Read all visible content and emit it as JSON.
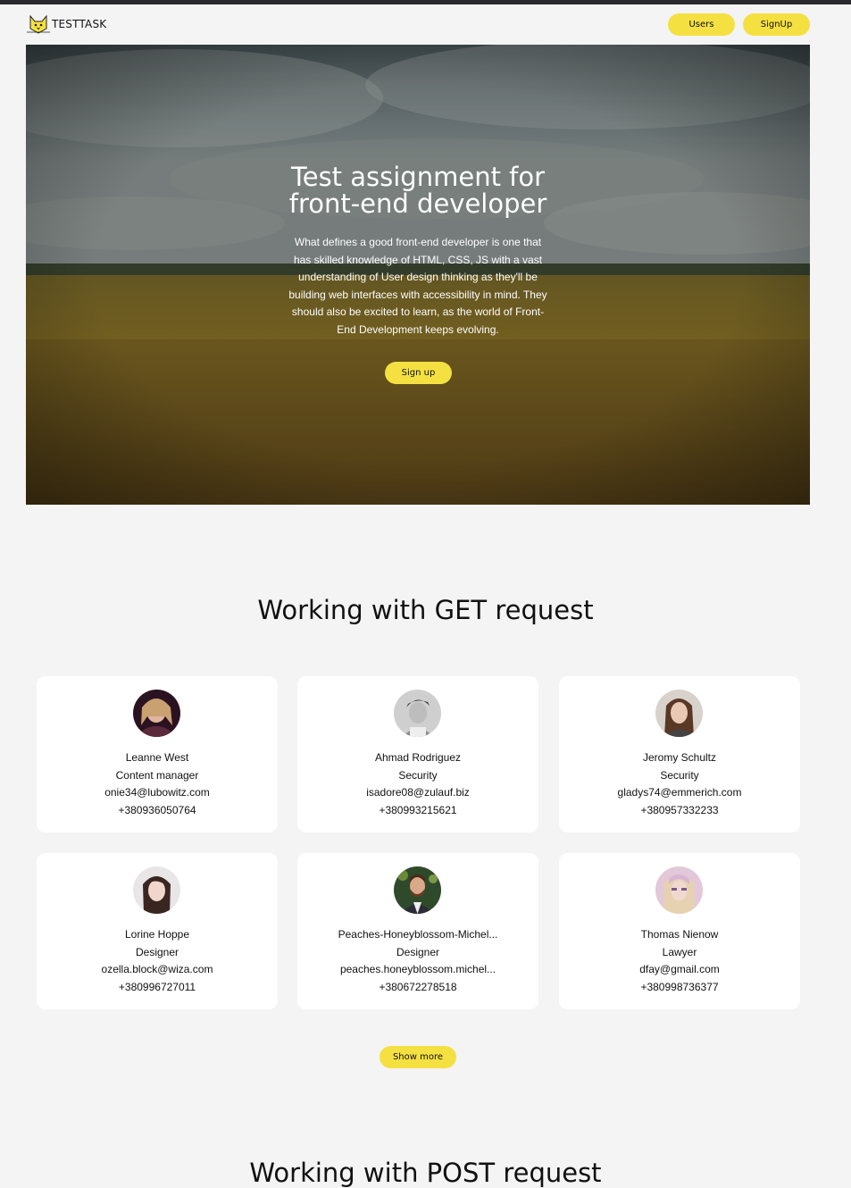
{
  "header": {
    "logo_text": "TESTTASK",
    "nav": {
      "users_label": "Users",
      "signup_label": "SignUp"
    }
  },
  "hero": {
    "title_line1": "Test assignment for",
    "title_line2": "front-end developer",
    "description": "What defines a good front-end developer is one that has skilled knowledge of HTML, CSS, JS with a vast understanding of User design thinking as they'll be building web interfaces with accessibility in mind. They should also be excited to learn, as the world of Front-End Development keeps evolving.",
    "button_label": "Sign up"
  },
  "get_section": {
    "title": "Working with GET request",
    "users": [
      {
        "name": "Leanne West",
        "position": "Content manager",
        "email": "onie34@lubowitz.com",
        "phone": "+380936050764"
      },
      {
        "name": "Ahmad Rodriguez",
        "position": "Security",
        "email": "isadore08@zulauf.biz",
        "phone": "+380993215621"
      },
      {
        "name": "Jeromy Schultz",
        "position": "Security",
        "email": "gladys74@emmerich.com",
        "phone": "+380957332233"
      },
      {
        "name": "Lorine Hoppe",
        "position": "Designer",
        "email": "ozella.block@wiza.com",
        "phone": "+380996727011"
      },
      {
        "name": "Peaches-Honeyblossom-Michel...",
        "position": "Designer",
        "email": "peaches.honeyblossom.michel...",
        "phone": "+380672278518"
      },
      {
        "name": "Thomas Nienow",
        "position": "Lawyer",
        "email": "dfay@gmail.com",
        "phone": "+380998736377"
      }
    ],
    "show_more_label": "Show more"
  },
  "post_section": {
    "title": "Working with POST request"
  },
  "colors": {
    "accent": "#f4e041",
    "background": "#f4f4f4",
    "card": "#ffffff",
    "text": "#111111"
  }
}
